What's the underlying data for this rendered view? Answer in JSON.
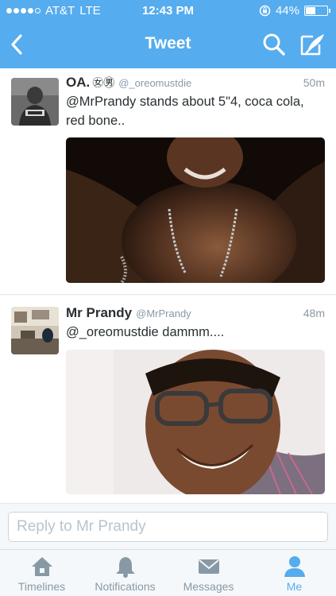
{
  "status_bar": {
    "carrier": "AT&T",
    "network": "LTE",
    "time": "12:43 PM",
    "battery": "44%",
    "battery_level": 0.44
  },
  "nav": {
    "title": "Tweet",
    "icons": [
      "chevron-left-icon",
      "search-icon",
      "compose-icon"
    ]
  },
  "tweets": [
    {
      "name": "OA.",
      "badge": "㊛㊚",
      "handle": "@_oreomustdie",
      "time": "50m",
      "text": "@MrPrandy stands about 5\"4, coca cola, red bone..",
      "media": "photo"
    },
    {
      "name": "Mr Prandy",
      "handle": "@MrPrandy",
      "time": "48m",
      "text": "@_oreomustdie dammm....",
      "media": "photo"
    }
  ],
  "reply": {
    "placeholder": "Reply to Mr Prandy"
  },
  "tabs": [
    {
      "label": "Timelines",
      "icon": "home-icon"
    },
    {
      "label": "Notifications",
      "icon": "bell-icon"
    },
    {
      "label": "Messages",
      "icon": "envelope-icon"
    },
    {
      "label": "Me",
      "icon": "person-icon",
      "active": true
    }
  ],
  "colors": {
    "brand": "#55acee",
    "text": "#292f33",
    "muted": "#8899a6"
  }
}
